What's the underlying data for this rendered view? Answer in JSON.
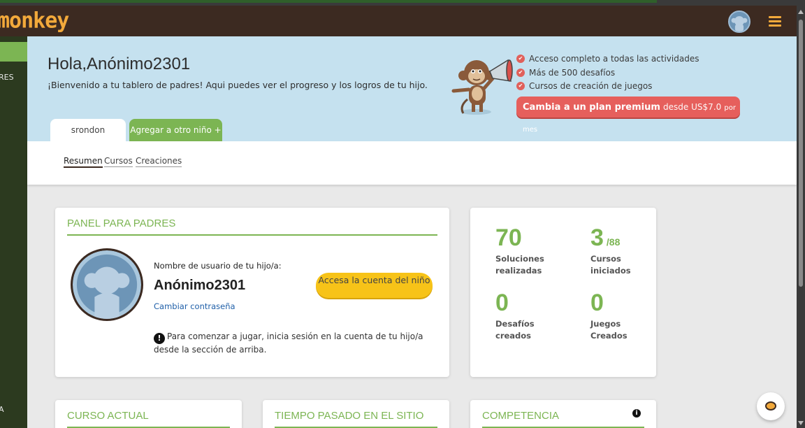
{
  "app": {
    "logo": "monkey"
  },
  "sidebar": {
    "labels": [
      "RES",
      "A"
    ]
  },
  "hero": {
    "greeting": "Hola,Anónimo2301",
    "welcome": "¡Bienvenido a tu tablero de padres! Aqui puedes ver el progreso y los logros de tu hijo.",
    "benefits": [
      "Acceso completo a todas las actividades",
      "Más de 500 desafíos",
      "Cursos de creación de juegos"
    ],
    "premium": {
      "bold": "Cambia a un plan premium",
      "price": "desde US$7.0",
      "per": "por mes"
    }
  },
  "tabs": {
    "child": "srondon",
    "add": "Agregar a otro niño +"
  },
  "subnav": [
    "Resumen",
    "Cursos",
    "Creaciones"
  ],
  "panel": {
    "title": "PANEL PARA PADRES",
    "username_label": "Nombre de usuario de tu hijo/a:",
    "username": "Anónimo2301",
    "change_password": "Cambiar contraseña",
    "access_button": "Accesa la cuenta del niño",
    "notice": "Para comenzar a jugar, inicia sesión en la cuenta de tu hijo/a desde la sección de arriba."
  },
  "stats": {
    "solutions": {
      "value": "70",
      "label": "Soluciones realizadas"
    },
    "courses": {
      "value": "3",
      "total": "/88",
      "label": "Cursos iniciados"
    },
    "challenges": {
      "value": "0",
      "label": "Desafíos creados"
    },
    "games": {
      "value": "0",
      "label": "Juegos Creados"
    }
  },
  "cards_bottom": {
    "current_course": "CURSO ACTUAL",
    "time_spent": "TIEMPO PASADO EN EL SITIO",
    "competence": "COMPETENCIA"
  },
  "colors": {
    "accent_green": "#7cb553",
    "brown": "#3c2a21",
    "hero_bg": "#c5e1ef",
    "premium_red": "#e65f5c",
    "yellow": "#f7c318"
  }
}
